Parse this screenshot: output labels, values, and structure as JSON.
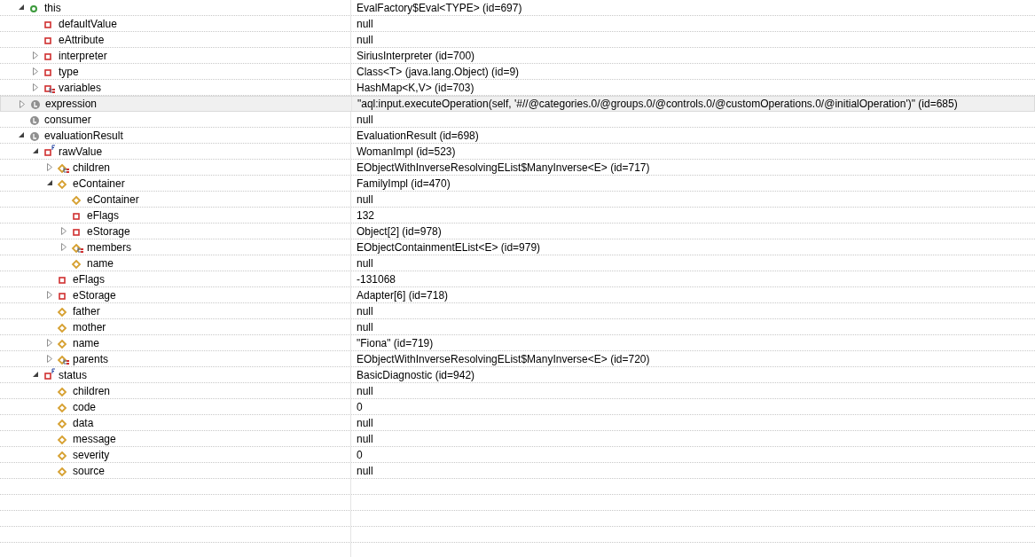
{
  "variables": [
    {
      "name": "this",
      "value": "EvalFactory$Eval<TYPE>  (id=697)",
      "kind": "public",
      "expanded": true,
      "selected": false,
      "children": [
        {
          "name": "defaultValue",
          "value": "null",
          "kind": "private",
          "selected": false
        },
        {
          "name": "eAttribute",
          "value": "null",
          "kind": "private",
          "selected": false
        },
        {
          "name": "interpreter",
          "value": "SiriusInterpreter  (id=700)",
          "kind": "private",
          "expanded": false,
          "selected": false
        },
        {
          "name": "type",
          "value": "Class<T> (java.lang.Object) (id=9)",
          "kind": "private",
          "expanded": false,
          "selected": false
        },
        {
          "name": "variables",
          "value": "HashMap<K,V>  (id=703)",
          "kind": "private_collection",
          "expanded": false,
          "selected": false
        }
      ]
    },
    {
      "name": "expression",
      "value": "\"aql:input.executeOperation(self, '#//@categories.0/@groups.0/@controls.0/@customOperations.0/@initialOperation')\" (id=685)",
      "kind": "local",
      "expanded": false,
      "selected": true
    },
    {
      "name": "consumer",
      "value": "null",
      "kind": "local",
      "selected": false
    },
    {
      "name": "evaluationResult",
      "value": "EvaluationResult  (id=698)",
      "kind": "local",
      "expanded": true,
      "selected": false,
      "children": [
        {
          "name": "rawValue",
          "value": "WomanImpl  (id=523)",
          "kind": "private_final",
          "expanded": true,
          "selected": false,
          "children": [
            {
              "name": "children",
              "value": "EObjectWithInverseResolvingEList$ManyInverse<E>  (id=717)",
              "kind": "protected_collection",
              "expanded": false,
              "selected": false
            },
            {
              "name": "eContainer",
              "value": "FamilyImpl  (id=470)",
              "kind": "protected",
              "expanded": true,
              "selected": false,
              "children": [
                {
                  "name": "eContainer",
                  "value": "null",
                  "kind": "protected",
                  "selected": false
                },
                {
                  "name": "eFlags",
                  "value": "132",
                  "kind": "private",
                  "selected": false
                },
                {
                  "name": "eStorage",
                  "value": "Object[2]  (id=978)",
                  "kind": "private",
                  "expanded": false,
                  "selected": false
                },
                {
                  "name": "members",
                  "value": "EObjectContainmentEList<E>  (id=979)",
                  "kind": "protected_collection",
                  "expanded": false,
                  "selected": false
                },
                {
                  "name": "name",
                  "value": "null",
                  "kind": "protected",
                  "selected": false
                }
              ]
            },
            {
              "name": "eFlags",
              "value": "-131068",
              "kind": "private",
              "selected": false
            },
            {
              "name": "eStorage",
              "value": "Adapter[6]  (id=718)",
              "kind": "private",
              "expanded": false,
              "selected": false
            },
            {
              "name": "father",
              "value": "null",
              "kind": "protected",
              "selected": false
            },
            {
              "name": "mother",
              "value": "null",
              "kind": "protected",
              "selected": false
            },
            {
              "name": "name",
              "value": "\"Fiona\" (id=719)",
              "kind": "protected",
              "expanded": false,
              "selected": false
            },
            {
              "name": "parents",
              "value": "EObjectWithInverseResolvingEList$ManyInverse<E>  (id=720)",
              "kind": "protected_collection",
              "expanded": false,
              "selected": false
            }
          ]
        },
        {
          "name": "status",
          "value": "BasicDiagnostic  (id=942)",
          "kind": "private_final",
          "expanded": true,
          "selected": false,
          "children": [
            {
              "name": "children",
              "value": "null",
              "kind": "protected",
              "selected": false
            },
            {
              "name": "code",
              "value": "0",
              "kind": "protected",
              "selected": false
            },
            {
              "name": "data",
              "value": "null",
              "kind": "protected",
              "selected": false
            },
            {
              "name": "message",
              "value": "null",
              "kind": "protected",
              "selected": false
            },
            {
              "name": "severity",
              "value": "0",
              "kind": "protected",
              "selected": false
            },
            {
              "name": "source",
              "value": "null",
              "kind": "protected",
              "selected": false
            }
          ]
        }
      ]
    }
  ]
}
